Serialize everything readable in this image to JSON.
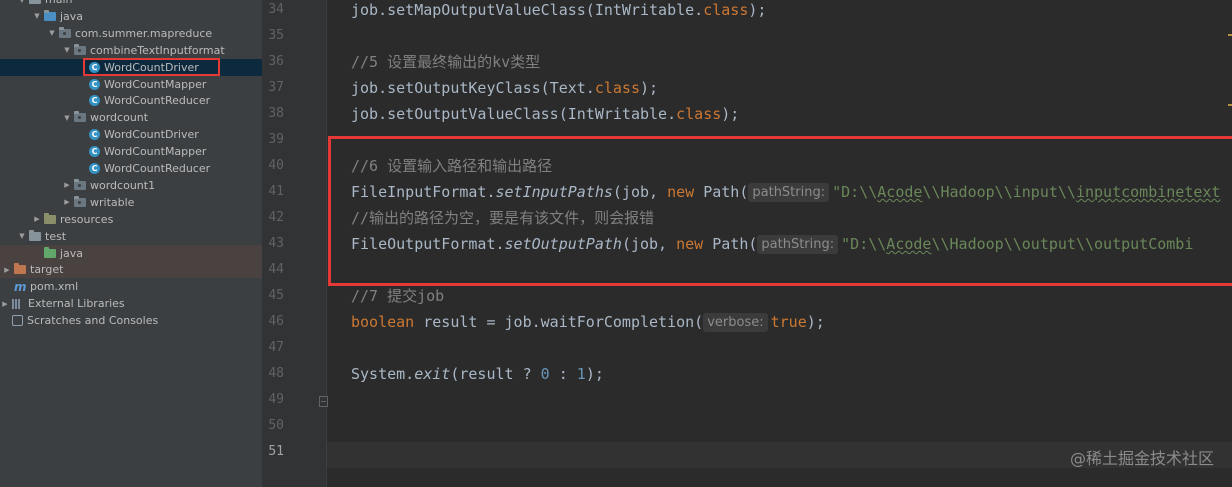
{
  "project_tree": [
    {
      "label": "main",
      "indent": 1,
      "arrow": "open",
      "icon": "folder-icon"
    },
    {
      "label": "java",
      "indent": 2,
      "arrow": "open",
      "icon": "source-folder-icon"
    },
    {
      "label": "com.summer.mapreduce",
      "indent": 3,
      "arrow": "open",
      "icon": "package-icon"
    },
    {
      "label": "combineTextInputformat",
      "indent": 4,
      "arrow": "open",
      "icon": "package-icon"
    },
    {
      "label": "WordCountDriver",
      "indent": 5,
      "arrow": "none",
      "icon": "java-class-icon",
      "selected": true
    },
    {
      "label": "WordCountMapper",
      "indent": 5,
      "arrow": "none",
      "icon": "java-class-icon"
    },
    {
      "label": "WordCountReducer",
      "indent": 5,
      "arrow": "none",
      "icon": "java-class-icon"
    },
    {
      "label": "wordcount",
      "indent": 4,
      "arrow": "open",
      "icon": "package-icon"
    },
    {
      "label": "WordCountDriver",
      "indent": 5,
      "arrow": "none",
      "icon": "java-class-icon"
    },
    {
      "label": "WordCountMapper",
      "indent": 5,
      "arrow": "none",
      "icon": "java-class-icon"
    },
    {
      "label": "WordCountReducer",
      "indent": 5,
      "arrow": "none",
      "icon": "java-class-icon"
    },
    {
      "label": "wordcount1",
      "indent": 4,
      "arrow": "closed",
      "icon": "package-icon"
    },
    {
      "label": "writable",
      "indent": 4,
      "arrow": "closed",
      "icon": "package-icon"
    },
    {
      "label": "resources",
      "indent": 2,
      "arrow": "closed",
      "icon": "resources-folder-icon"
    },
    {
      "label": "test",
      "indent": 1,
      "arrow": "open",
      "icon": "folder-icon"
    },
    {
      "label": "java",
      "indent": 2,
      "arrow": "none",
      "icon": "test-folder-icon",
      "highlight": true
    },
    {
      "label": "target",
      "indent": 0,
      "arrow": "closed",
      "icon": "excluded-folder-icon",
      "highlight": true
    },
    {
      "label": "pom.xml",
      "indent": 0,
      "arrow": "none",
      "icon": "maven-icon"
    },
    {
      "label": "External Libraries",
      "indent": -1,
      "arrow": "closed",
      "icon": "libraries-icon"
    },
    {
      "label": "Scratches and Consoles",
      "indent": -1,
      "arrow": "none",
      "icon": "scratches-icon"
    }
  ],
  "editor": {
    "current_line": "51",
    "lines": [
      {
        "num": "34",
        "segs": [
          [
            "job.setMapOutputValueClass(IntWritable.",
            ""
          ],
          [
            "class",
            "kw"
          ],
          [
            ");",
            ""
          ]
        ]
      },
      {
        "num": "35",
        "segs": []
      },
      {
        "num": "36",
        "segs": [
          [
            "//5 设置最终输出的kv类型",
            "comment"
          ]
        ]
      },
      {
        "num": "37",
        "segs": [
          [
            "job.setOutputKeyClass(Text.",
            ""
          ],
          [
            "class",
            "kw"
          ],
          [
            ");",
            ""
          ]
        ]
      },
      {
        "num": "38",
        "segs": [
          [
            "job.setOutputValueClass(IntWritable.",
            ""
          ],
          [
            "class",
            "kw"
          ],
          [
            ");",
            ""
          ]
        ]
      },
      {
        "num": "39",
        "segs": []
      },
      {
        "num": "40",
        "segs": [
          [
            "//6 设置输入路径和输出路径",
            "comment"
          ]
        ]
      },
      {
        "num": "41",
        "segs": [
          [
            "FileInputFormat.",
            ""
          ],
          [
            "setInputPaths",
            "italic-static"
          ],
          [
            "(job, ",
            ""
          ],
          [
            "new ",
            "kw"
          ],
          [
            "Path(",
            ""
          ],
          [
            "pathString:",
            "hint"
          ],
          [
            "\"D:\\\\",
            "str"
          ],
          [
            "Acode",
            "str-u"
          ],
          [
            "\\\\Hadoop\\\\input\\\\",
            "str"
          ],
          [
            "inputcombinetext",
            "str-u"
          ]
        ]
      },
      {
        "num": "42",
        "segs": [
          [
            "//输出的路径为空，要是有该文件，则会报错",
            "comment"
          ]
        ]
      },
      {
        "num": "43",
        "segs": [
          [
            "FileOutputFormat.",
            ""
          ],
          [
            "setOutputPath",
            "italic-static"
          ],
          [
            "(job, ",
            ""
          ],
          [
            "new ",
            "kw"
          ],
          [
            "Path(",
            ""
          ],
          [
            "pathString:",
            "hint"
          ],
          [
            "\"D:\\\\",
            "str"
          ],
          [
            "Acode",
            "str-u"
          ],
          [
            "\\\\Hadoop\\\\output\\\\outputCombi",
            "str"
          ]
        ]
      },
      {
        "num": "44",
        "segs": []
      },
      {
        "num": "45",
        "segs": [
          [
            "//7 提交job",
            "comment"
          ]
        ]
      },
      {
        "num": "46",
        "segs": [
          [
            "boolean ",
            "kw"
          ],
          [
            "result = job.waitForCompletion(",
            ""
          ],
          [
            "verbose:",
            "hint"
          ],
          [
            "true",
            "kw"
          ],
          [
            ");",
            ""
          ]
        ]
      },
      {
        "num": "47",
        "segs": []
      },
      {
        "num": "48",
        "segs": [
          [
            "System.",
            ""
          ],
          [
            "exit",
            "italic-static"
          ],
          [
            "(result ? ",
            ""
          ],
          [
            "0",
            "num"
          ],
          [
            " : ",
            ""
          ],
          [
            "1",
            "num"
          ],
          [
            ");",
            ""
          ]
        ]
      },
      {
        "num": "49",
        "segs": []
      },
      {
        "num": "50",
        "segs": []
      },
      {
        "num": "51",
        "segs": []
      }
    ]
  },
  "watermark": "@稀土掘金技术社区"
}
